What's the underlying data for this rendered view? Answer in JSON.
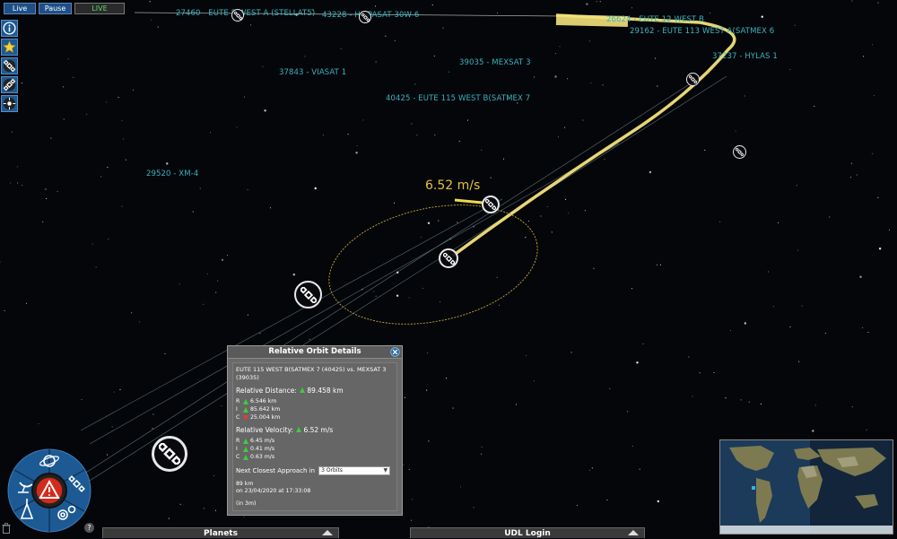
{
  "controls": {
    "live_label": "Live",
    "pause_label": "Pause",
    "status_label": "LIVE"
  },
  "side_toolbar": [
    "info-icon",
    "favorites-star-icon",
    "satellite-icon",
    "satellite-alt-icon",
    "radar-icon"
  ],
  "satellite_labels": [
    "27460 - EUTE 5 WEST A (STELLAT5)",
    "43228 - HISPASAT 30W-6",
    "39035 - MEXSAT 3",
    "37843 - VIASAT 1",
    "40425 - EUTE 115 WEST B(SATMEX 7",
    "29520 - XM-4",
    "37237 - HYLAS 1",
    "29162 - EUTE 113 WEST A(SATMEX 6",
    "26624 - EUTE 12 WEST B"
  ],
  "relative_speed": "6.52 m/s",
  "panel": {
    "title": "Relative Orbit Details",
    "pair_title": "EUTE 115 WEST B(SATMEX 7 (40425) vs. MEXSAT 3 (39035)",
    "distance_label": "Relative Distance:",
    "distance_value": "89.458 km",
    "distance_components": [
      {
        "axis": "R",
        "trend": "up",
        "value": "6.546 km"
      },
      {
        "axis": "I",
        "trend": "up",
        "value": "85.642 km"
      },
      {
        "axis": "C",
        "trend": "down",
        "value": "25.004 km"
      }
    ],
    "velocity_label": "Relative Velocity:",
    "velocity_value": "6.52 m/s",
    "velocity_components": [
      {
        "axis": "R",
        "trend": "up",
        "value": "6.45 m/s"
      },
      {
        "axis": "I",
        "trend": "up",
        "value": "0.41 m/s"
      },
      {
        "axis": "C",
        "trend": "up",
        "value": "0.63 m/s"
      }
    ],
    "approach_label": "Next Closest Approach in",
    "approach_selected": "3 Orbits",
    "approach_distance": "89 km",
    "approach_time": "on 23/04/2020 at 17:33:08",
    "approach_relative": "(in 3m)"
  },
  "bottom_tabs": {
    "planets": "Planets",
    "udl_login": "UDL Login"
  },
  "radial_menu_icons": [
    "planet-icon",
    "alert-icon",
    "satellite-dish-icon",
    "satellite-icon",
    "rocket-launch-icon",
    "settings-gear-icon"
  ],
  "colors": {
    "label_cyan": "#3bb3c0",
    "orbit_yellow": "#f2e27a",
    "speed_gold": "#e4c23a",
    "button_blue": "#1f4f86",
    "alert_red": "#d42a1c"
  }
}
